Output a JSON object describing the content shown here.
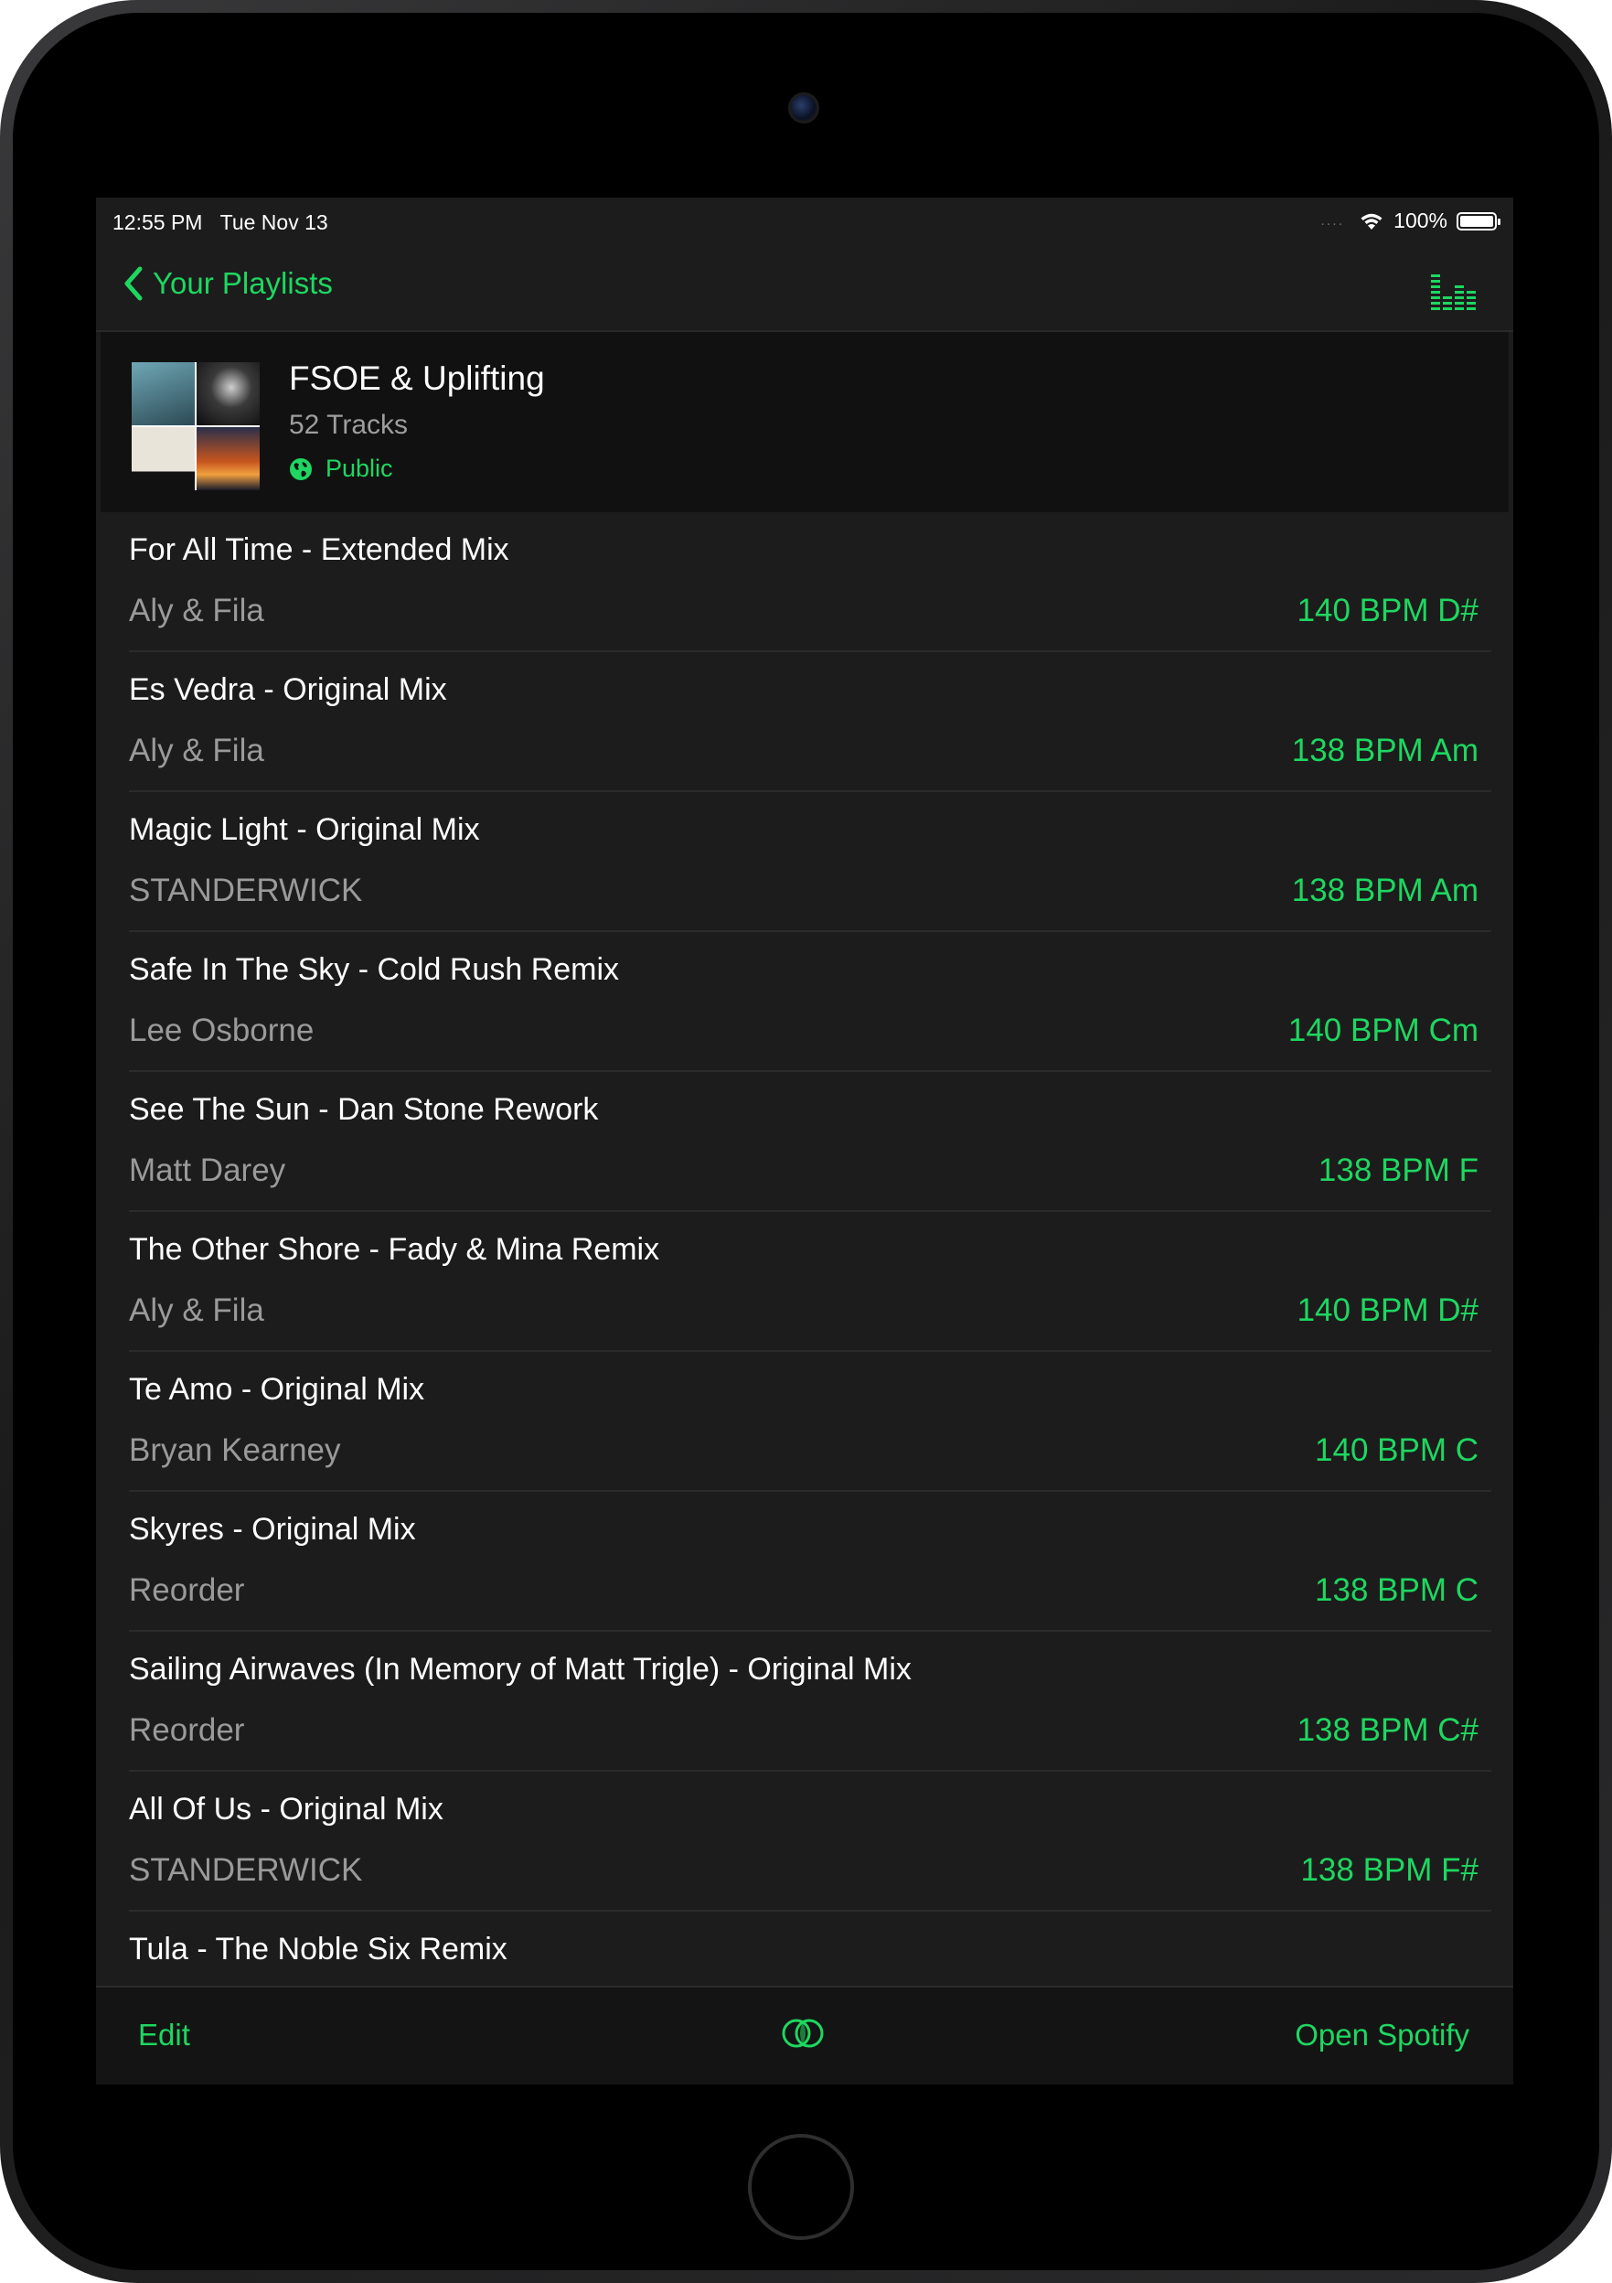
{
  "status_bar": {
    "time": "12:55 PM",
    "date": "Tue Nov 13",
    "signal": "....",
    "battery": "100%"
  },
  "nav": {
    "back_label": "Your Playlists",
    "right_icon": "equalizer-icon"
  },
  "playlist": {
    "title": "FSOE & Uplifting",
    "track_count": "52 Tracks",
    "visibility": "Public"
  },
  "tracks": [
    {
      "title": "For All Time - Extended Mix",
      "artist": "Aly & Fila",
      "meta": "140 BPM D#"
    },
    {
      "title": "Es Vedra - Original Mix",
      "artist": "Aly & Fila",
      "meta": "138 BPM Am"
    },
    {
      "title": "Magic Light - Original Mix",
      "artist": "STANDERWICK",
      "meta": "138 BPM Am"
    },
    {
      "title": "Safe In The Sky - Cold Rush Remix",
      "artist": "Lee Osborne",
      "meta": "140 BPM Cm"
    },
    {
      "title": "See The Sun - Dan Stone Rework",
      "artist": "Matt Darey",
      "meta": "138 BPM F"
    },
    {
      "title": "The Other Shore - Fady & Mina Remix",
      "artist": "Aly & Fila",
      "meta": "140 BPM D#"
    },
    {
      "title": "Te Amo - Original Mix",
      "artist": "Bryan Kearney",
      "meta": "140 BPM C"
    },
    {
      "title": "Skyres - Original Mix",
      "artist": "Reorder",
      "meta": "138 BPM C"
    },
    {
      "title": "Sailing Airwaves (In Memory of Matt Trigle) - Original Mix",
      "artist": "Reorder",
      "meta": "138 BPM C#"
    },
    {
      "title": "All Of Us - Original Mix",
      "artist": "STANDERWICK",
      "meta": "138 BPM F#"
    },
    {
      "title": "Tula - The Noble Six Remix",
      "artist": "",
      "meta": ""
    }
  ],
  "toolbar": {
    "edit_label": "Edit",
    "center_icon": "overlap-circles-icon",
    "open_label": "Open Spotify"
  },
  "colors": {
    "accent": "#1ed760",
    "background": "#1c1c1c",
    "header_bg": "#111111"
  }
}
